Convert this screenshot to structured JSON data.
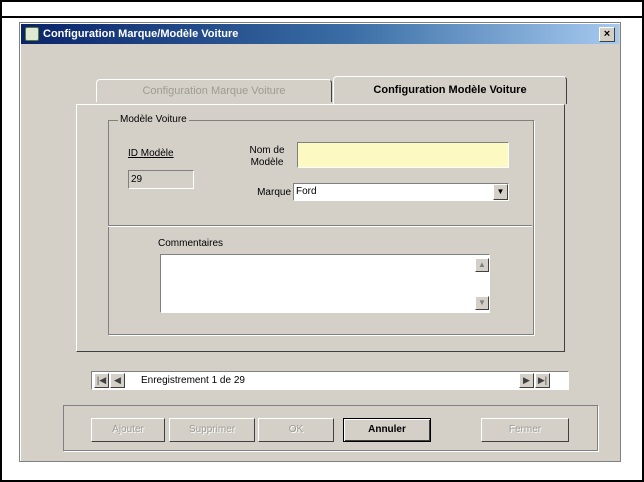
{
  "window": {
    "title": "Configuration Marque/Modèle Voiture",
    "close_glyph": "×"
  },
  "tabs": [
    {
      "label": "Configuration Marque Voiture",
      "active": false
    },
    {
      "label": "Configuration Modèle Voiture",
      "active": true
    }
  ],
  "group": {
    "legend": "Modèle Voiture",
    "id_label": "ID Modèle",
    "id_value": "29",
    "nom_label_1": "Nom de",
    "nom_label_2": "Modèle",
    "nom_value": "",
    "marque_label": "Marque",
    "marque_value": "Ford",
    "comment_label": "Commentaires",
    "comment_value": ""
  },
  "navigator": {
    "first_glyph": "|◀",
    "prev_glyph": "◀",
    "next_glyph": "▶",
    "last_glyph": "▶|",
    "record_text": "Enregistrement 1 de 29"
  },
  "buttons": [
    {
      "label": "Ajouter",
      "enabled": false
    },
    {
      "label": "Supprimer",
      "enabled": false
    },
    {
      "label": "OK",
      "enabled": false
    },
    {
      "label": "Annuler",
      "enabled": true
    },
    {
      "label": "Fermer",
      "enabled": false
    }
  ],
  "colors": {
    "title_start": "#0a246a",
    "title_end": "#a6caf0",
    "face": "#d4d0c8",
    "required_field": "#fdf9c3"
  }
}
